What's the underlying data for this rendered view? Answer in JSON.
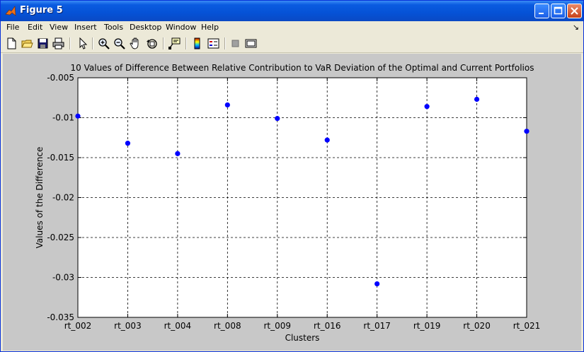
{
  "window": {
    "title": "Figure 5",
    "menu": [
      "File",
      "Edit",
      "View",
      "Insert",
      "Tools",
      "Desktop",
      "Window",
      "Help"
    ]
  },
  "toolbar": {
    "icons": [
      "new-figure-icon",
      "open-file-icon",
      "save-icon",
      "print-icon",
      "edit-plot-arrow-icon",
      "zoom-in-icon",
      "zoom-out-icon",
      "pan-hand-icon",
      "rotate-3d-icon",
      "data-cursor-icon",
      "colorbar-icon",
      "legend-icon",
      "hide-plot-tools-icon",
      "show-plot-tools-icon"
    ]
  },
  "chart_data": {
    "type": "scatter",
    "title": "10 Values of Difference Between Relative Contribution to VaR Deviation of the Optimal and Current Portfolios",
    "xlabel": "Clusters",
    "ylabel": "Values of the Difference",
    "categories": [
      "rt_002",
      "rt_003",
      "rt_004",
      "rt_008",
      "rt_009",
      "rt_016",
      "rt_017",
      "rt_019",
      "rt_020",
      "rt_021"
    ],
    "values": [
      -0.0098,
      -0.0132,
      -0.0145,
      -0.0084,
      -0.0101,
      -0.0128,
      -0.0308,
      -0.0086,
      -0.0077,
      -0.0117
    ],
    "yticks": [
      "-0.005",
      "-0.01",
      "-0.015",
      "-0.02",
      "-0.025",
      "-0.03",
      "-0.035"
    ],
    "ylim": [
      -0.035,
      -0.005
    ],
    "grid": true,
    "marker_color": "#0000ff"
  }
}
